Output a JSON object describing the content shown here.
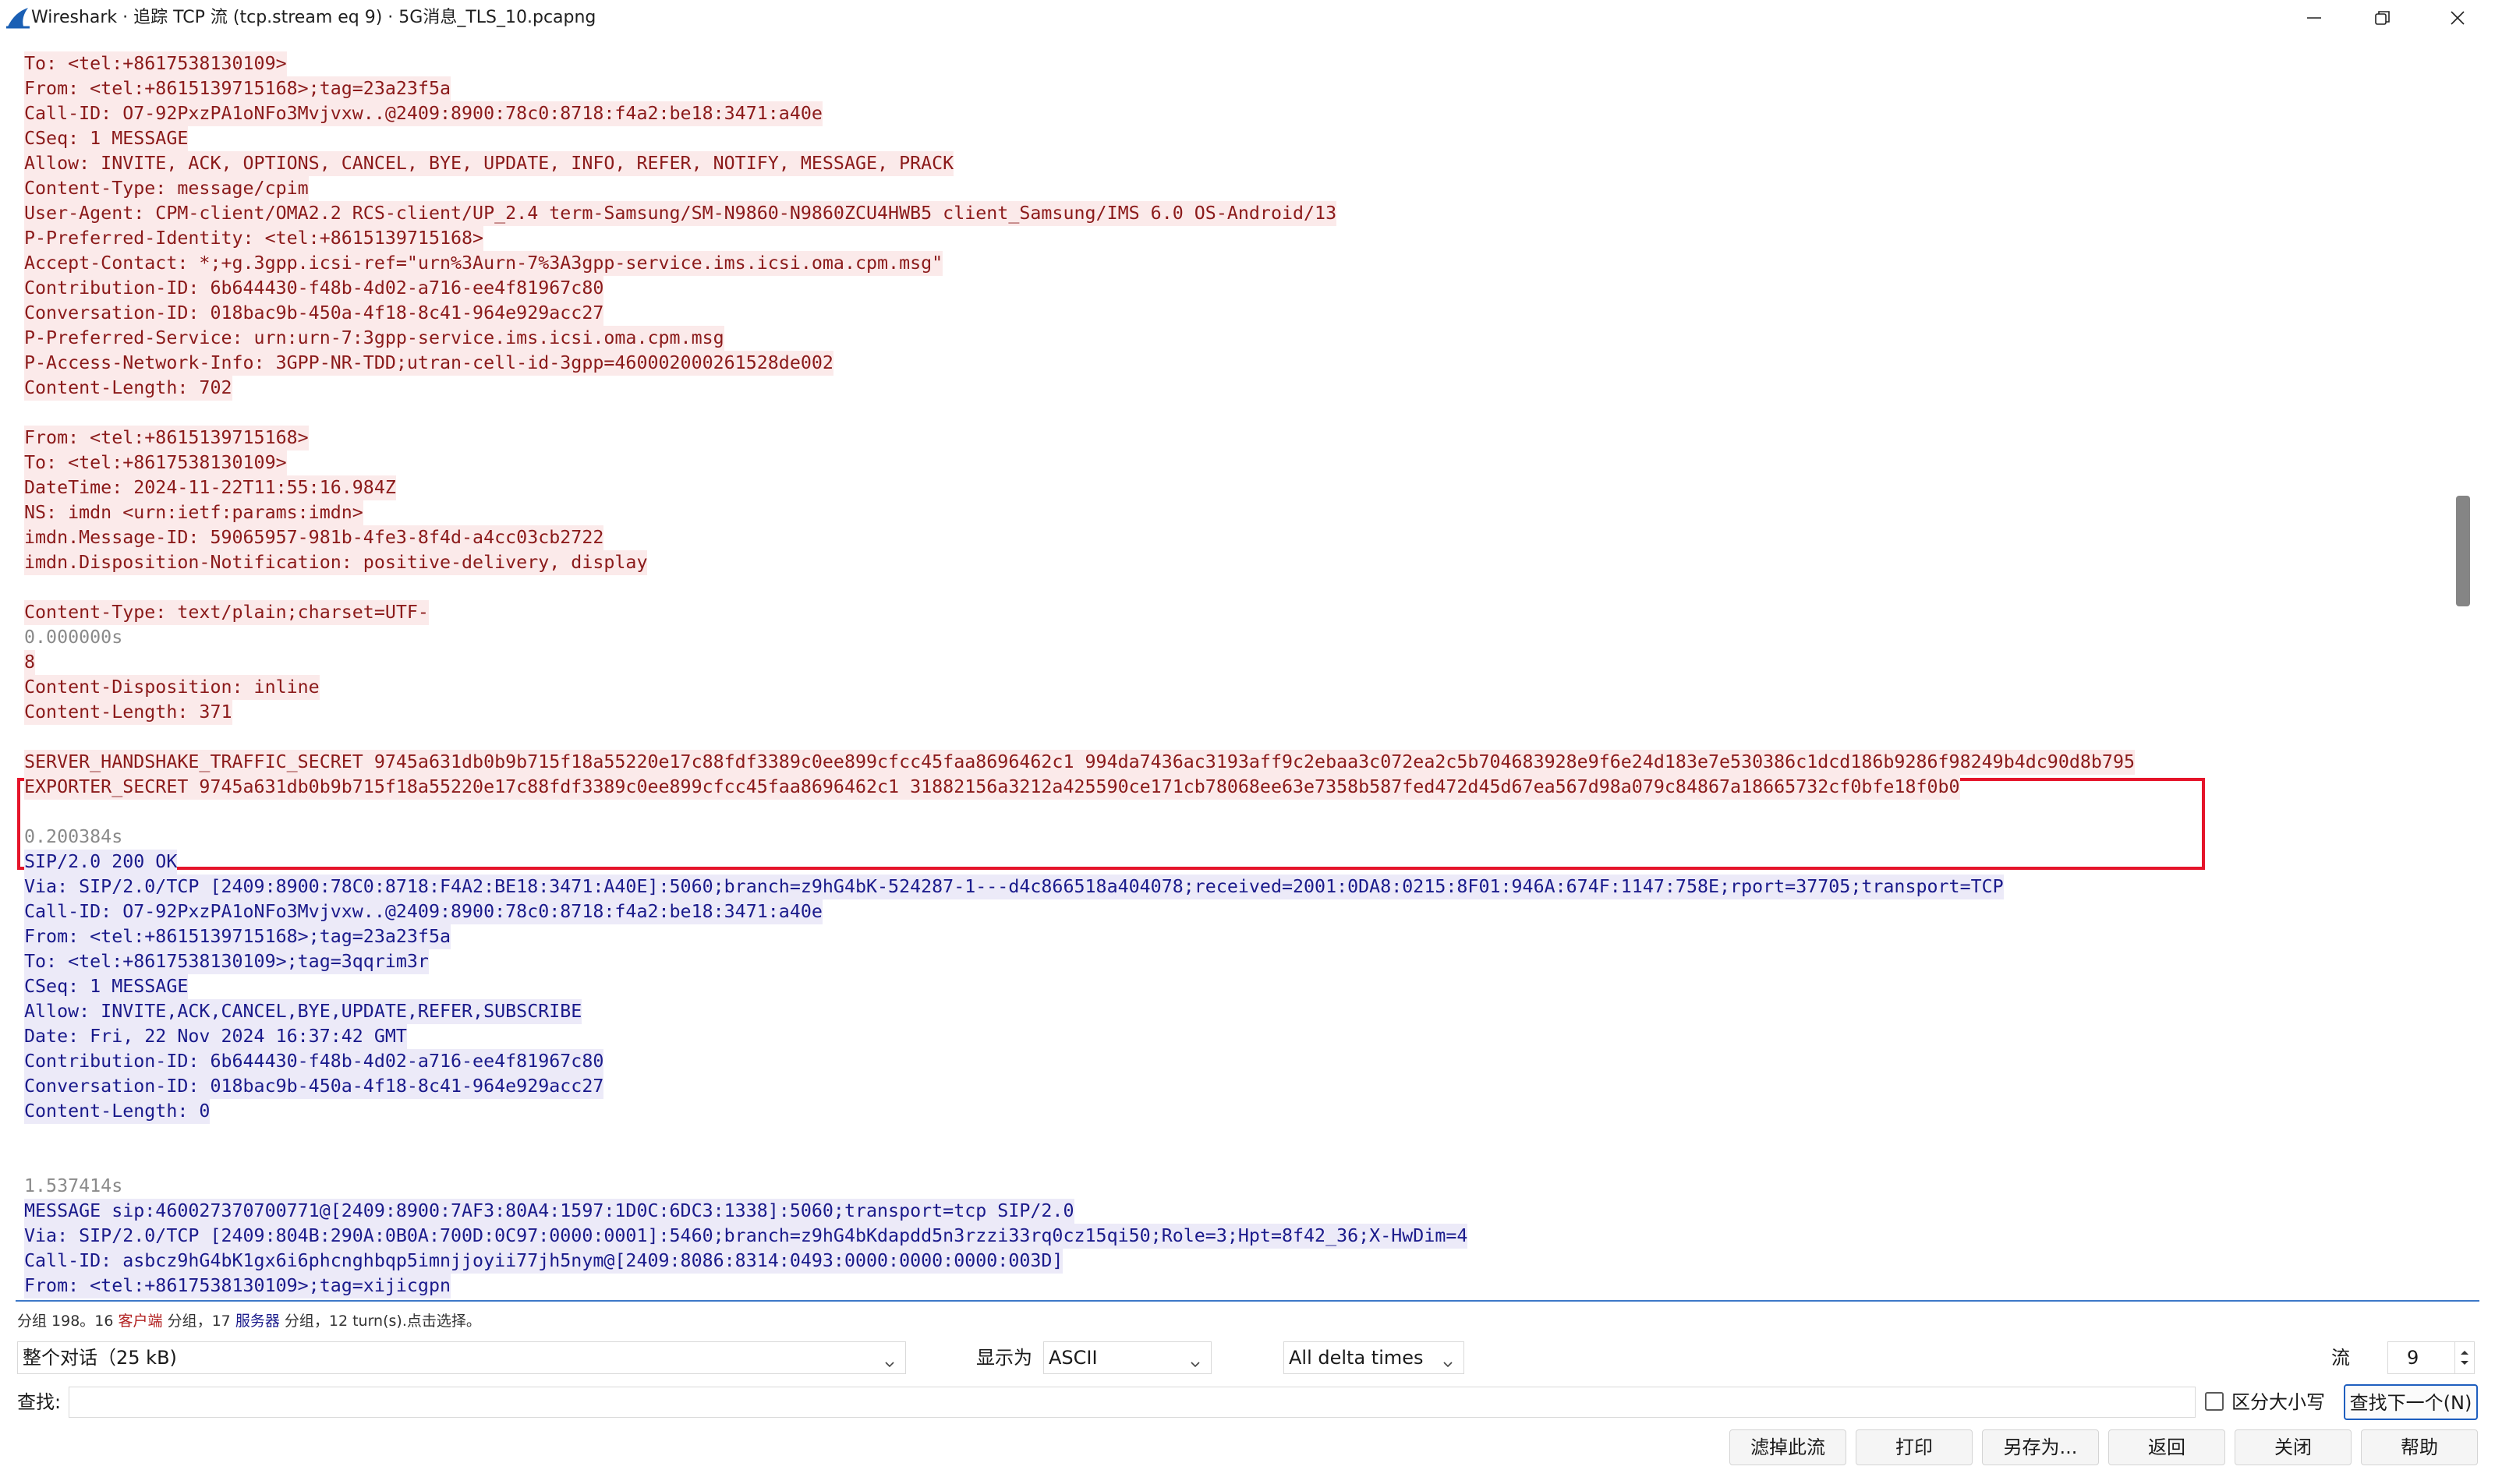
{
  "window": {
    "title": "Wireshark · 追踪 TCP 流 (tcp.stream eq 9) · 5G消息_TLS_10.pcapng"
  },
  "stream_lines": [
    {
      "text": "To: <tel:+8617538130109>",
      "type": "client"
    },
    {
      "text": "From: <tel:+8615139715168>;tag=23a23f5a",
      "type": "client"
    },
    {
      "text": "Call-ID: O7-92PxzPA1oNFo3Mvjvxw..@2409:8900:78c0:8718:f4a2:be18:3471:a40e",
      "type": "client"
    },
    {
      "text": "CSeq: 1 MESSAGE",
      "type": "client"
    },
    {
      "text": "Allow: INVITE, ACK, OPTIONS, CANCEL, BYE, UPDATE, INFO, REFER, NOTIFY, MESSAGE, PRACK",
      "type": "client"
    },
    {
      "text": "Content-Type: message/cpim",
      "type": "client"
    },
    {
      "text": "User-Agent: CPM-client/OMA2.2 RCS-client/UP_2.4 term-Samsung/SM-N9860-N9860ZCU4HWB5 client_Samsung/IMS 6.0 OS-Android/13",
      "type": "client"
    },
    {
      "text": "P-Preferred-Identity: <tel:+8615139715168>",
      "type": "client"
    },
    {
      "text": "Accept-Contact: *;+g.3gpp.icsi-ref=\"urn%3Aurn-7%3A3gpp-service.ims.icsi.oma.cpm.msg\"",
      "type": "client"
    },
    {
      "text": "Contribution-ID: 6b644430-f48b-4d02-a716-ee4f81967c80",
      "type": "client"
    },
    {
      "text": "Conversation-ID: 018bac9b-450a-4f18-8c41-964e929acc27",
      "type": "client"
    },
    {
      "text": "P-Preferred-Service: urn:urn-7:3gpp-service.ims.icsi.oma.cpm.msg",
      "type": "client"
    },
    {
      "text": "P-Access-Network-Info: 3GPP-NR-TDD;utran-cell-id-3gpp=460002000261528de002",
      "type": "client"
    },
    {
      "text": "Content-Length: 702",
      "type": "client"
    },
    {
      "text": "",
      "type": "blank"
    },
    {
      "text": "From: <tel:+8615139715168>",
      "type": "client"
    },
    {
      "text": "To: <tel:+8617538130109>",
      "type": "client"
    },
    {
      "text": "DateTime: 2024-11-22T11:55:16.984Z",
      "type": "client"
    },
    {
      "text": "NS: imdn <urn:ietf:params:imdn>",
      "type": "client"
    },
    {
      "text": "imdn.Message-ID: 59065957-981b-4fe3-8f4d-a4cc03cb2722",
      "type": "client"
    },
    {
      "text": "imdn.Disposition-Notification: positive-delivery, display",
      "type": "client"
    },
    {
      "text": "",
      "type": "blank"
    },
    {
      "text": "Content-Type: text/plain;charset=UTF-",
      "type": "client"
    },
    {
      "text": "0.000000s",
      "type": "time"
    },
    {
      "text": "8",
      "type": "client"
    },
    {
      "text": "Content-Disposition: inline",
      "type": "client"
    },
    {
      "text": "Content-Length: 371",
      "type": "client"
    },
    {
      "text": "",
      "type": "blank"
    },
    {
      "text": "SERVER_HANDSHAKE_TRAFFIC_SECRET 9745a631db0b9b715f18a55220e17c88fdf3389c0ee899cfcc45faa8696462c1 994da7436ac3193aff9c2ebaa3c072ea2c5b704683928e9f6e24d183e7e530386c1dcd186b9286f98249b4dc90d8b795",
      "type": "client"
    },
    {
      "text": "EXPORTER_SECRET 9745a631db0b9b715f18a55220e17c88fdf3389c0ee899cfcc45faa8696462c1 31882156a3212a425590ce171cb78068ee63e7358b587fed472d45d67ea567d98a079c84867a18665732cf0bfe18f0b0",
      "type": "client"
    },
    {
      "text": "",
      "type": "blank"
    },
    {
      "text": "0.200384s",
      "type": "time"
    },
    {
      "text": "SIP/2.0 200 OK",
      "type": "server"
    },
    {
      "text": "Via: SIP/2.0/TCP [2409:8900:78C0:8718:F4A2:BE18:3471:A40E]:5060;branch=z9hG4bK-524287-1---d4c866518a404078;received=2001:0DA8:0215:8F01:946A:674F:1147:758E;rport=37705;transport=TCP",
      "type": "server"
    },
    {
      "text": "Call-ID: O7-92PxzPA1oNFo3Mvjvxw..@2409:8900:78c0:8718:f4a2:be18:3471:a40e",
      "type": "server"
    },
    {
      "text": "From: <tel:+8615139715168>;tag=23a23f5a",
      "type": "server"
    },
    {
      "text": "To: <tel:+8617538130109>;tag=3qqrim3r",
      "type": "server"
    },
    {
      "text": "CSeq: 1 MESSAGE",
      "type": "server"
    },
    {
      "text": "Allow: INVITE,ACK,CANCEL,BYE,UPDATE,REFER,SUBSCRIBE",
      "type": "server"
    },
    {
      "text": "Date: Fri, 22 Nov 2024 16:37:42 GMT",
      "type": "server"
    },
    {
      "text": "Contribution-ID: 6b644430-f48b-4d02-a716-ee4f81967c80",
      "type": "server"
    },
    {
      "text": "Conversation-ID: 018bac9b-450a-4f18-8c41-964e929acc27",
      "type": "server"
    },
    {
      "text": "Content-Length: 0",
      "type": "server"
    },
    {
      "text": "",
      "type": "blank"
    },
    {
      "text": "",
      "type": "blank"
    },
    {
      "text": "1.537414s",
      "type": "time"
    },
    {
      "text": "MESSAGE sip:460027370700771@[2409:8900:7AF3:80A4:1597:1D0C:6DC3:1338]:5060;transport=tcp SIP/2.0",
      "type": "server"
    },
    {
      "text": "Via: SIP/2.0/TCP [2409:804B:290A:0B0A:700D:0C97:0000:0001]:5460;branch=z9hG4bKdapdd5n3rzzi33rq0cz15qi50;Role=3;Hpt=8f42_36;X-HwDim=4",
      "type": "server"
    },
    {
      "text": "Call-ID: asbcz9hG4bK1gx6i6phcnghbqp5imnjjoyii77jh5nym@[2409:8086:8314:0493:0000:0000:0000:003D]",
      "type": "server"
    },
    {
      "text": "From: <tel:+8617538130109>;tag=xijicgpn",
      "type": "server"
    }
  ],
  "status": {
    "prefix": "分组 198。16 ",
    "client_word": "客户端",
    "middle": " 分组，17 ",
    "server_word": "服务器",
    "suffix": " 分组，12 turn(s).点击选择。"
  },
  "controls": {
    "conversation_select": "整个对话（25 kB)",
    "show_as_label": "显示为",
    "show_as_value": "ASCII",
    "delta_select": "All delta times",
    "stream_label": "流",
    "stream_value": "9",
    "find_label": "查找:",
    "find_value": "",
    "case_sensitive_label": "区分大小写",
    "find_next_button": "查找下一个(N)"
  },
  "buttons": {
    "filter_out": "滤掉此流",
    "print": "打印",
    "save_as": "另存为...",
    "back": "返回",
    "close": "关闭",
    "help": "帮助"
  }
}
